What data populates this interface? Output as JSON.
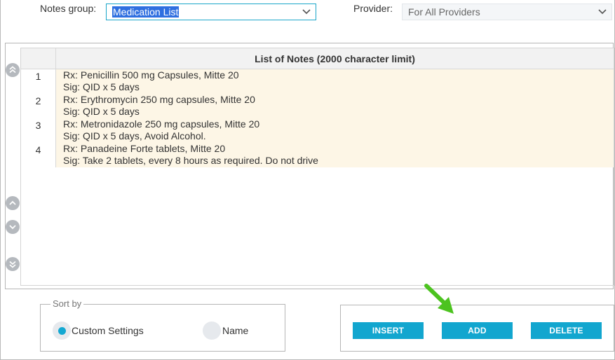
{
  "filters": {
    "notes_group_label": "Notes group:",
    "notes_group_value": "Medication List",
    "provider_label": "Provider:",
    "provider_value": "For All Providers"
  },
  "grid": {
    "header_title": "List of Notes (2000 character limit)",
    "rows": [
      {
        "num": "1",
        "line1": "Rx: Penicillin 500 mg Capsules, Mitte 20",
        "line2": "Sig: QID x 5 days"
      },
      {
        "num": "2",
        "line1": "Rx: Erythromycin 250 mg capsules, Mitte 20",
        "line2": "Sig: QID x 5 days"
      },
      {
        "num": "3",
        "line1": "Rx: Metronidazole 250 mg capsules, Mitte 20",
        "line2": "Sig: QID x 5 days, Avoid Alcohol."
      },
      {
        "num": "4",
        "line1": "Rx: Panadeine Forte tablets, Mitte 20",
        "line2": "Sig: Take 2 tablets, every 8 hours as required. Do not drive"
      }
    ]
  },
  "sort": {
    "legend": "Sort by",
    "options": [
      {
        "label": "Custom Settings",
        "selected": true
      },
      {
        "label": "Name",
        "selected": false
      }
    ]
  },
  "actions": {
    "insert_label": "INSERT",
    "add_label": "ADD",
    "delete_label": "DELETE"
  },
  "colors": {
    "accent": "#12a6cf",
    "row_bg": "#fdf6e6",
    "annotation_arrow": "#4cc31f"
  },
  "icons": {
    "dropdown": "chevron-down-icon",
    "move_top": "double-chevron-up-icon",
    "move_up": "chevron-up-icon",
    "move_down": "chevron-down-icon",
    "move_bottom": "double-chevron-down-icon",
    "annotation": "arrow-annotation-icon"
  }
}
